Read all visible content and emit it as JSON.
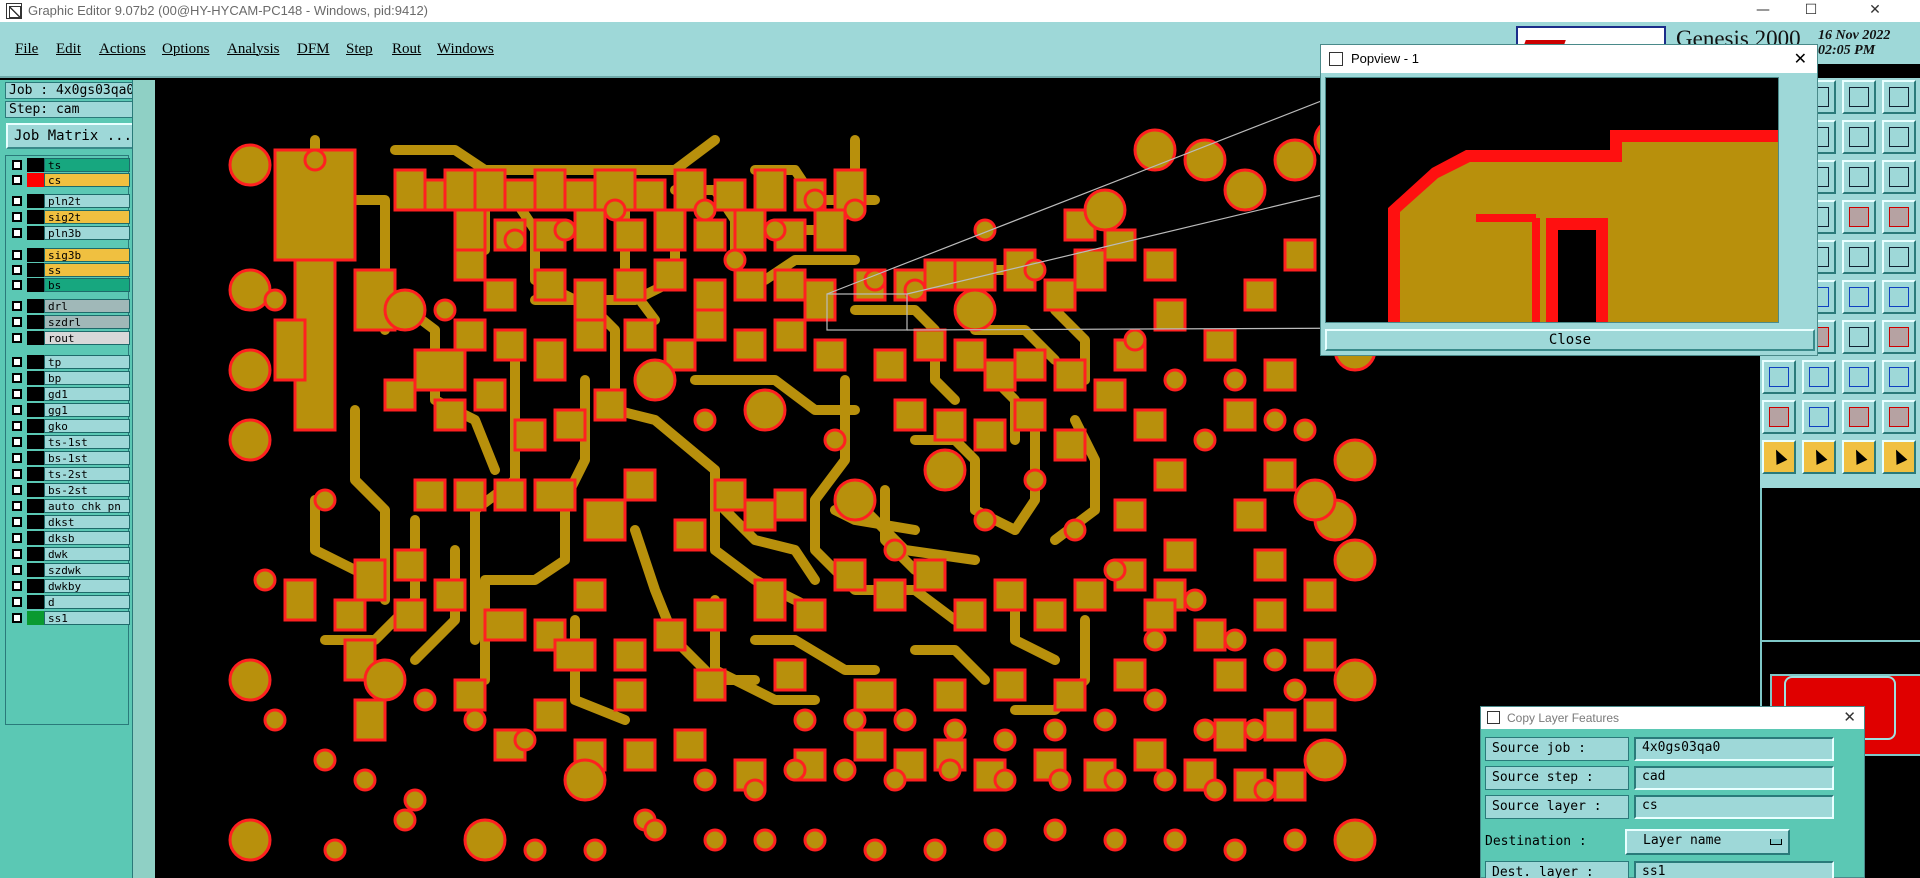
{
  "window": {
    "title": "Graphic Editor 9.07b2 (00@HY-HYCAM-PC148 - Windows, pid:9412)",
    "minimize": "—",
    "maximize": "☐",
    "close": "✕"
  },
  "menu": {
    "file": "File",
    "edit": "Edit",
    "actions": "Actions",
    "options": "Options",
    "analysis": "Analysis",
    "dfm": "DFM",
    "step": "Step",
    "rout": "Rout",
    "windows": "Windows"
  },
  "header": {
    "product": "Genesis 2000",
    "date": "16 Nov 2022",
    "time": "02:05 PM"
  },
  "job": {
    "job_line": "Job : 4x0gs03qa0",
    "step_line": "Step: cam",
    "matrix_button": "Job Matrix ..."
  },
  "layers": [
    {
      "name": "ts",
      "swatch": "#000000",
      "fill": "#17a77f"
    },
    {
      "name": "cs",
      "swatch": "#ff0000",
      "fill": "#f0c040"
    },
    {
      "name": "pln2t",
      "swatch": "#000000",
      "fill": "#9ed8d8"
    },
    {
      "name": "sig2t",
      "swatch": "#000000",
      "fill": "#f0c040"
    },
    {
      "name": "pln3b",
      "swatch": "#000000",
      "fill": "#9ed8d8"
    },
    {
      "name": "sig3b",
      "swatch": "#000000",
      "fill": "#f0c040"
    },
    {
      "name": "ss",
      "swatch": "#000000",
      "fill": "#f0c040"
    },
    {
      "name": "bs",
      "swatch": "#000000",
      "fill": "#17a77f"
    },
    {
      "name": "drl",
      "swatch": "#000000",
      "fill": "#a0b8b8"
    },
    {
      "name": "szdrl",
      "swatch": "#000000",
      "fill": "#a0b8b8"
    },
    {
      "name": "rout",
      "swatch": "#000000",
      "fill": "#d8d8d8"
    },
    {
      "name": "tp",
      "swatch": "#000000",
      "fill": "#9ed8d8"
    },
    {
      "name": "bp",
      "swatch": "#000000",
      "fill": "#9ed8d8"
    },
    {
      "name": "gd1",
      "swatch": "#000000",
      "fill": "#9ed8d8"
    },
    {
      "name": "gg1",
      "swatch": "#000000",
      "fill": "#9ed8d8"
    },
    {
      "name": "gko",
      "swatch": "#000000",
      "fill": "#9ed8d8"
    },
    {
      "name": "ts-1st",
      "swatch": "#000000",
      "fill": "#9ed8d8"
    },
    {
      "name": "bs-1st",
      "swatch": "#000000",
      "fill": "#9ed8d8"
    },
    {
      "name": "ts-2st",
      "swatch": "#000000",
      "fill": "#9ed8d8"
    },
    {
      "name": "bs-2st",
      "swatch": "#000000",
      "fill": "#9ed8d8"
    },
    {
      "name": "auto_chk_pn",
      "swatch": "#000000",
      "fill": "#9ed8d8"
    },
    {
      "name": "dkst",
      "swatch": "#000000",
      "fill": "#9ed8d8"
    },
    {
      "name": "dksb",
      "swatch": "#000000",
      "fill": "#9ed8d8"
    },
    {
      "name": "dwk",
      "swatch": "#000000",
      "fill": "#9ed8d8"
    },
    {
      "name": "szdwk",
      "swatch": "#000000",
      "fill": "#9ed8d8"
    },
    {
      "name": "dwkby",
      "swatch": "#000000",
      "fill": "#9ed8d8"
    },
    {
      "name": "d",
      "swatch": "#000000",
      "fill": "#9ed8d8"
    },
    {
      "name": "ss1",
      "swatch": "#0a9a30",
      "fill": "#9ed8d8"
    }
  ],
  "popview": {
    "title": "Popview - 1",
    "close_x": "✕",
    "close_button": "Close"
  },
  "copy_dialog": {
    "title": "Copy Layer Features",
    "close_x": "✕",
    "source_job_label": "Source job  :",
    "source_job_value": "4x0gs03qa0",
    "source_step_label": "Source step  :",
    "source_step_value": "cad",
    "source_layer_label": "Source layer :",
    "source_layer_value": "cs",
    "destination_label": "Destination  :",
    "destination_value": "Layer name",
    "dest_layer_label": "Dest. layer  :",
    "dest_layer_value": "ss1"
  },
  "colors": {
    "copper": "#b8900c",
    "pad_outline": "#ff2020",
    "ui_teal": "#9ed8d8",
    "panel_green": "#5bc8b4"
  }
}
